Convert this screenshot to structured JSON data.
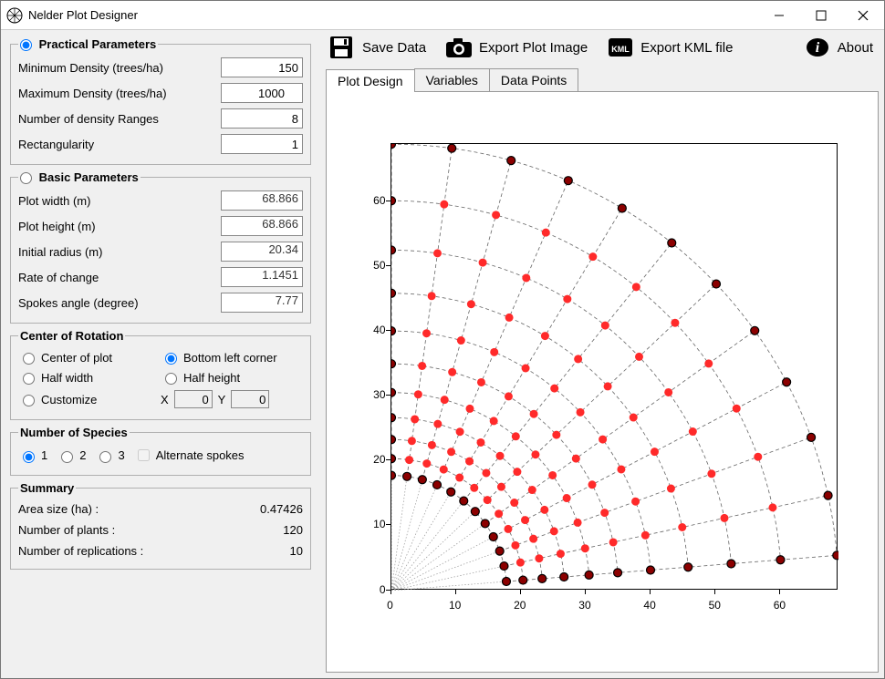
{
  "app": {
    "title": "Nelder Plot Designer"
  },
  "toolbar": {
    "save": "Save Data",
    "exportImg": "Export Plot Image",
    "exportKml": "Export KML file",
    "about": "About"
  },
  "tabs": {
    "t0": "Plot Design",
    "t1": "Variables",
    "t2": "Data Points"
  },
  "practical": {
    "legend": "Practical Parameters",
    "minDensLbl": "Minimum Density (trees/ha)",
    "minDens": "150",
    "maxDensLbl": "Maximum Density (trees/ha)",
    "maxDens": "1000",
    "rangesLbl": "Number of density Ranges",
    "ranges": "8",
    "rectLbl": "Rectangularity",
    "rect": "1"
  },
  "basic": {
    "legend": "Basic Parameters",
    "pwLbl": "Plot width (m)",
    "pw": "68.866",
    "phLbl": "Plot height (m)",
    "ph": "68.866",
    "irLbl": "Initial radius (m)",
    "ir": "20.34",
    "rocLbl": "Rate of change",
    "roc": "1.1451",
    "saLbl": "Spokes angle (degree)",
    "sa": "7.77"
  },
  "center": {
    "legend": "Center of Rotation",
    "cp": "Center of plot",
    "bl": "Bottom left corner",
    "hw": "Half width",
    "hh": "Half height",
    "cu": "Customize",
    "xLbl": "X",
    "x": "0",
    "yLbl": "Y",
    "y": "0"
  },
  "species": {
    "legend": "Number of Species",
    "o1": "1",
    "o2": "2",
    "o3": "3",
    "alt": "Alternate spokes"
  },
  "summary": {
    "legend": "Summary",
    "areaLbl": "Area size (ha) :",
    "area": "0.47426",
    "plantsLbl": "Number of plants :",
    "plants": "120",
    "repsLbl": "Number of replications :",
    "reps": "10"
  },
  "chart_data": {
    "type": "scatter",
    "title": "",
    "xlabel": "",
    "ylabel": "",
    "xlim": [
      0,
      68.866
    ],
    "ylim": [
      0,
      68.866
    ],
    "xticks": [
      0,
      10,
      20,
      30,
      40,
      50,
      60
    ],
    "yticks": [
      0,
      10,
      20,
      30,
      40,
      50,
      60
    ],
    "spoke_angle_deg": 7.77,
    "spoke_count": 12,
    "initial_radius": 20.34,
    "rate_of_change": 1.1451,
    "radii": [
      17.76,
      20.34,
      23.29,
      26.67,
      30.54,
      34.97,
      40.04,
      45.85,
      52.5,
      60.12,
      68.84
    ],
    "border_arc_indices": [
      0,
      10
    ],
    "border_spoke_indices": [
      0,
      11
    ]
  }
}
